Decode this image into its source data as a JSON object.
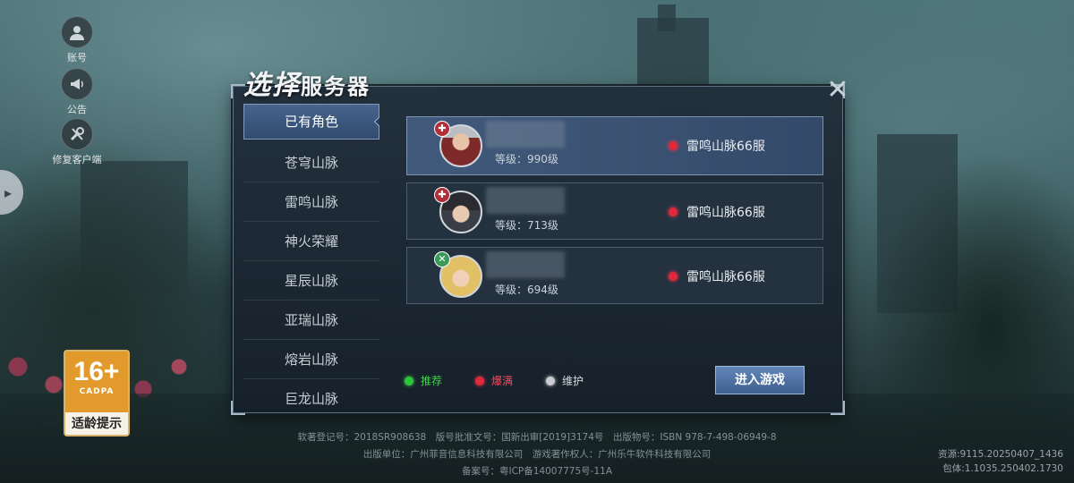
{
  "left_menu": {
    "account": "账号",
    "notice": "公告",
    "repair": "修复客户端"
  },
  "age_badge": {
    "rating": "16+",
    "org": "CADPA",
    "label": "适龄提示"
  },
  "dialog": {
    "title_main": "选择",
    "title_rest": "服务器",
    "tabs": [
      "已有角色",
      "苍穹山脉",
      "雷鸣山脉",
      "神火荣耀",
      "星辰山脉",
      "亚瑞山脉",
      "熔岩山脉",
      "巨龙山脉"
    ],
    "characters": [
      {
        "level_text": "等级：990级",
        "server": "雷鸣山脉66服",
        "status_color": "#e0283a"
      },
      {
        "level_text": "等级：713级",
        "server": "雷鸣山脉66服",
        "status_color": "#e0283a"
      },
      {
        "level_text": "等级：694级",
        "server": "雷鸣山脉66服",
        "status_color": "#e0283a"
      }
    ],
    "legend": {
      "recommend": "推荐",
      "full": "爆满",
      "maintenance": "维护"
    },
    "legend_colors": {
      "recommend": "#2fc53a",
      "full": "#e0283a",
      "maintenance": "#c9ccd0"
    },
    "enter_button": "进入游戏"
  },
  "footer": {
    "line1": "软著登记号：2018SR908638　版号批准文号：国新出审[2019]3174号　出版物号：ISBN 978-7-498-06949-8",
    "line2": "出版单位：广州菲音信息科技有限公司　游戏著作权人：广州乐牛软件科技有限公司",
    "line3": "备案号：粤ICP备14007775号-11A"
  },
  "version": {
    "resource": "资源:9115.20250407_1436",
    "package": "包体:1.1035.250402.1730"
  }
}
